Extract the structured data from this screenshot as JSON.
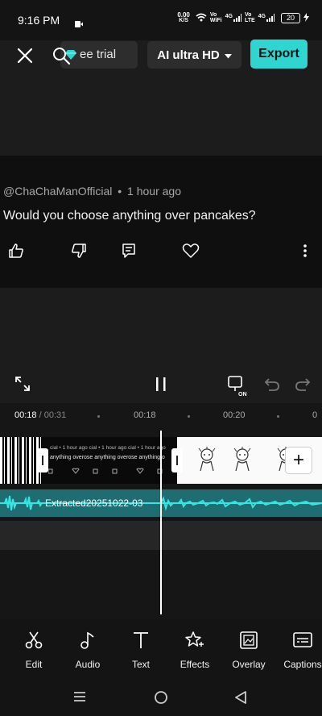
{
  "status_bar": {
    "time": "9:16 PM",
    "speed_value": "0.00",
    "speed_unit": "K/S",
    "net1_top": "Vo",
    "net1_bottom": "WiFi",
    "net2_gen": "4G",
    "net3_top": "Vo",
    "net3_bottom": "LTE",
    "net4_gen": "4G",
    "battery": "20"
  },
  "top_bar": {
    "trial_label": "ee trial",
    "quality_label": "AI ultra HD",
    "export_label": "Export"
  },
  "comment": {
    "author": "@ChaChaManOfficial",
    "time": "1 hour ago",
    "separator": "•",
    "text": "Would you choose anything over pancakes?"
  },
  "timeline": {
    "current_time": "00:18",
    "total_time": "/ 00:31",
    "marks": [
      "00:18",
      "00:20"
    ],
    "audio_clip_label": "Extracted20251022-03",
    "clip_caption_small": "cial • 1 hour ago      cial • 1 hour ago      cial • 1 hour ago",
    "clip_caption_main": "anything overose anything overose anything o"
  },
  "toolbar": {
    "items": [
      {
        "label": "Edit"
      },
      {
        "label": "Audio"
      },
      {
        "label": "Text"
      },
      {
        "label": "Effects"
      },
      {
        "label": "Overlay"
      },
      {
        "label": "Captions"
      }
    ]
  },
  "colors": {
    "accent": "#2fd6d1",
    "audio_track": "#1f6c72",
    "background": "#1c1c1c"
  }
}
